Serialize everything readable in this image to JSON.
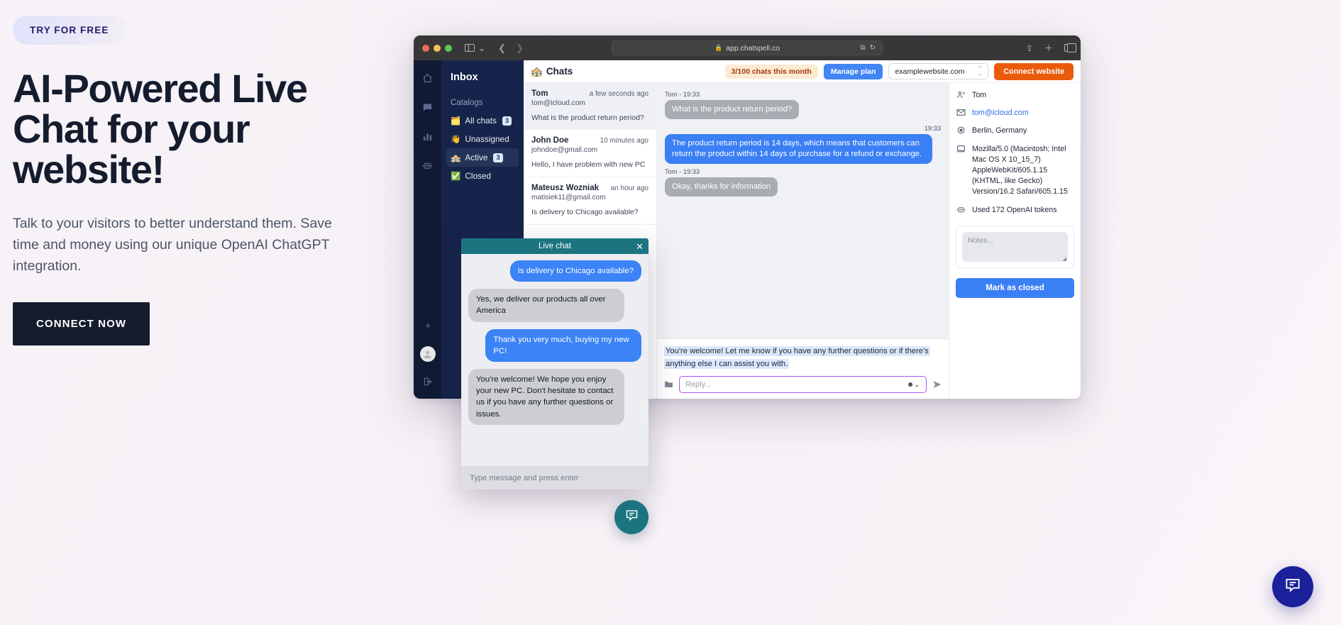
{
  "hero": {
    "pill": "TRY FOR FREE",
    "heading": "AI-Powered Live Chat for your website!",
    "subheading": "Talk to your visitors to better understand them. Save time and money using our unique OpenAI ChatGPT integration.",
    "cta": "CONNECT NOW"
  },
  "browser": {
    "url": "app.chatspell.co",
    "lock_icon": "lock-icon"
  },
  "app": {
    "rail_icons": [
      "home-icon",
      "chat-icon",
      "analytics-icon",
      "bot-icon",
      "gear-icon",
      "avatar-icon",
      "logout-icon"
    ],
    "inbox": {
      "title": "Inbox",
      "catalogs_label": "Catalogs",
      "items": [
        {
          "emoji": "🗂️",
          "label": "All chats",
          "badge": "3",
          "active": false
        },
        {
          "emoji": "👋",
          "label": "Unassigned",
          "badge": "",
          "active": false
        },
        {
          "emoji": "🏤",
          "label": "Active",
          "badge": "3",
          "active": true
        },
        {
          "emoji": "✅",
          "label": "Closed",
          "badge": "",
          "active": false
        }
      ]
    },
    "header": {
      "title": "Chats",
      "title_emoji": "🏤",
      "quota": "3/100 chats this month",
      "manage_plan": "Manage plan",
      "website_selected": "examplewebsite.com",
      "connect_website": "Connect website"
    },
    "chat_list": [
      {
        "name": "Tom",
        "time": "a few seconds ago",
        "email": "tom@icloud.com",
        "preview": "What is the product return period?",
        "selected": true
      },
      {
        "name": "John Doe",
        "time": "10 minutes ago",
        "email": "johndoe@gmail.com",
        "preview": "Hello, I have problem with new PC",
        "selected": false
      },
      {
        "name": "Mateusz Wozniak",
        "time": "an hour ago",
        "email": "matisiek11@gmail.com",
        "preview": "Is delivery to Chicago available?",
        "selected": false
      }
    ],
    "conversation": {
      "messages": [
        {
          "meta": "Tom - 19:33",
          "side": "in",
          "text": "What is the product return period?"
        },
        {
          "meta": "19:33",
          "side": "out",
          "text": "The product return period is 14 days, which means that customers can return the product within 14 days of purchase for a refund or exchange."
        },
        {
          "meta": "Tom - 19:33",
          "side": "in",
          "text": "Okay, thanks for information"
        }
      ],
      "suggestion": "You're welcome! Let me know if you have any further questions or if there's anything else I can assist you with.",
      "reply_placeholder": "Reply...",
      "folder_icon": "folder-icon",
      "emoji_icon": "emoji-picker-icon",
      "send_icon": "send-icon"
    },
    "contact": {
      "rows": [
        {
          "icon": "user-icon",
          "text": "Tom",
          "link": false
        },
        {
          "icon": "mail-icon",
          "text": "tom@icloud.com",
          "link": true
        },
        {
          "icon": "location-icon",
          "text": "Berlin, Germany",
          "link": false
        },
        {
          "icon": "device-icon",
          "text": "Mozilla/5.0 (Macintosh; Intel Mac OS X 10_15_7) AppleWebKit/605.1.15 (KHTML, like Gecko) Version/16.2 Safari/605.1.15",
          "link": false
        },
        {
          "icon": "bot-icon",
          "text": "Used 172 OpenAI tokens",
          "link": false
        }
      ],
      "notes_placeholder": "Notes...",
      "mark_closed": "Mark as closed"
    }
  },
  "widget": {
    "title": "Live chat",
    "close_icon": "close-icon",
    "messages": [
      {
        "side": "me",
        "text": "Is delivery to Chicago available?"
      },
      {
        "side": "them",
        "text": "Yes, we deliver our products all over America"
      },
      {
        "side": "me",
        "text": "Thank you very much, buying my new PC!"
      },
      {
        "side": "them",
        "text": "You're welcome! We hope you enjoy your new PC. Don't hesitate to contact us if you have any further questions or issues."
      }
    ],
    "input_placeholder": "Type message and press enter"
  },
  "fabs": {
    "teal_icon": "chat-bubble-icon",
    "navy_icon": "chat-bubble-icon"
  },
  "colors": {
    "accent_navy": "#141c2e",
    "brand_blue": "#3b7ff5",
    "brand_orange": "#ea5a0b",
    "teal": "#1b7480",
    "widget_navy": "#1b219a"
  }
}
